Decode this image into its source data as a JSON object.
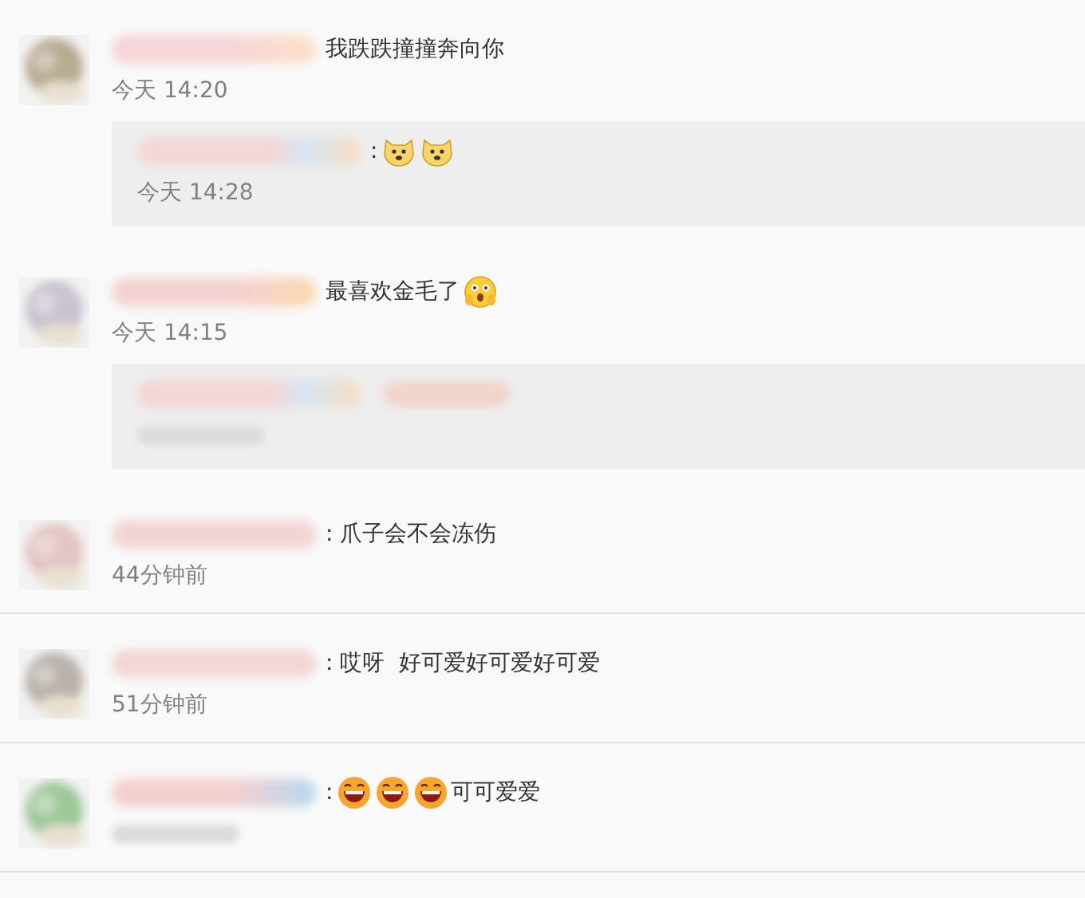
{
  "comments": [
    {
      "content": [
        {
          "kind": "text",
          "text": "我跌跌撞撞奔向你"
        }
      ],
      "time": "今天 14:20",
      "replies": [
        {
          "redacted": false,
          "content": [
            {
              "kind": "text",
              "text": ":"
            },
            {
              "kind": "dog-emoji"
            },
            {
              "kind": "dog-emoji"
            }
          ],
          "time": "今天 14:28"
        }
      ]
    },
    {
      "content": [
        {
          "kind": "text",
          "text": "最喜欢金毛了"
        },
        {
          "kind": "shocked-emoji"
        }
      ],
      "time": "今天 14:15",
      "replies": [
        {
          "redacted": true
        }
      ]
    },
    {
      "content": [
        {
          "kind": "text",
          "text": ": 爪子会不会冻伤"
        }
      ],
      "time": "44分钟前"
    },
    {
      "content": [
        {
          "kind": "text",
          "text": ": 哎呀  好可爱好可爱好可爱"
        }
      ],
      "time": "51分钟前"
    },
    {
      "content": [
        {
          "kind": "text",
          "text": ":"
        },
        {
          "kind": "laugh-emoji"
        },
        {
          "kind": "laugh-emoji"
        },
        {
          "kind": "laugh-emoji"
        },
        {
          "kind": "text",
          "text": "可可爱爱"
        }
      ]
    }
  ]
}
